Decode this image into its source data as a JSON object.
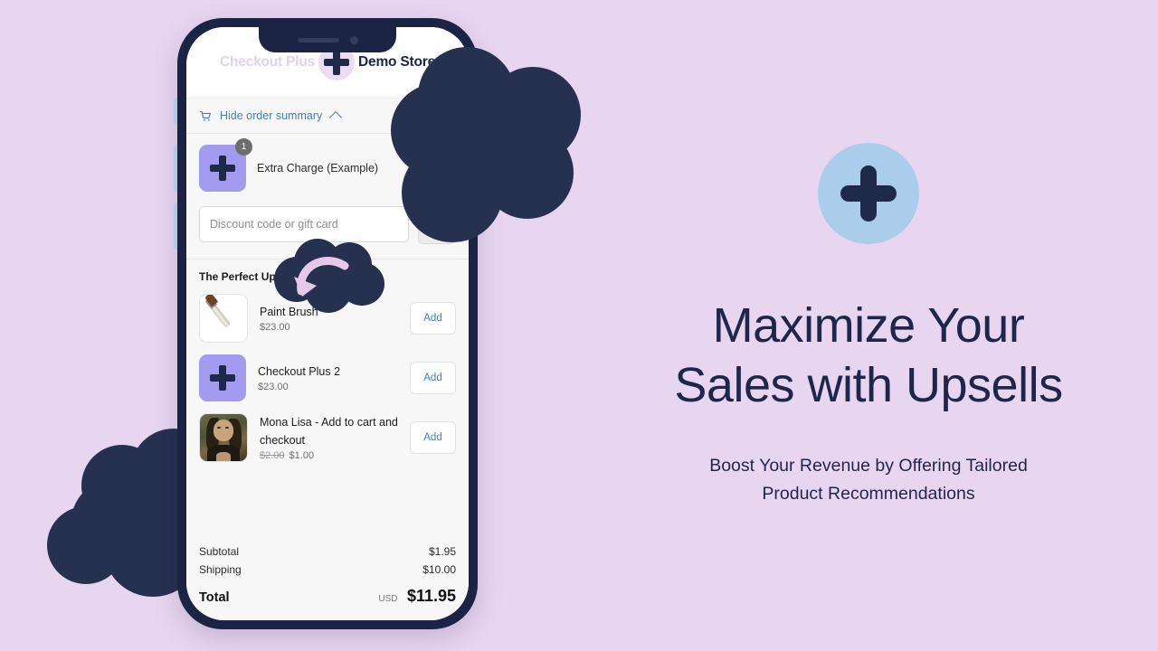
{
  "theme": {
    "background": "#e8d6f1",
    "navy": "#26304f",
    "accent_blue": "#3f7fd0",
    "badge_blue": "#a9cdeb",
    "tile_purple": "#a39bf0"
  },
  "phone": {
    "notch": {
      "speaker": "speaker-bar",
      "camera": "camera-dot"
    },
    "side_buttons": [
      "mute-switch",
      "volume-up",
      "volume-down"
    ]
  },
  "checkout": {
    "header": {
      "ghost_brand": "Checkout Plus",
      "logo_icon": "plus-icon",
      "store_name": "Demo Store"
    },
    "order_summary": {
      "cart_icon": "cart-icon",
      "toggle_label": "Hide order summary",
      "chevron_icon": "chevron-up-icon"
    },
    "cart_items": [
      {
        "thumb": "plus-icon",
        "quantity": "1",
        "title": "Extra Charge (Example)"
      }
    ],
    "discount": {
      "placeholder": "Discount code or gift card",
      "value": "",
      "apply_icon": "arrow-right-icon"
    },
    "upsell": {
      "title": "The Perfect Upsell",
      "items": [
        {
          "thumb": "paint-brush-image",
          "name": "Paint Brush",
          "price": "$23.00",
          "compare_price": "",
          "action": "Add"
        },
        {
          "thumb": "plus-icon",
          "name": "Checkout Plus 2",
          "price": "$23.00",
          "compare_price": "",
          "action": "Add"
        },
        {
          "thumb": "mona-lisa-image",
          "name": "Mona Lisa - Add to cart and checkout",
          "price": "$1.00",
          "compare_price": "$2.00",
          "action": "Add"
        }
      ]
    },
    "totals": {
      "subtotal_label": "Subtotal",
      "subtotal_value": "$1.95",
      "shipping_label": "Shipping",
      "shipping_value": "$10.00",
      "total_label": "Total",
      "currency": "USD",
      "total_value": "$11.95"
    }
  },
  "marketing": {
    "badge_icon": "plus-icon",
    "headline_line1": "Maximize Your",
    "headline_line2": "Sales with Upsells",
    "subhead_line1": "Boost Your Revenue by Offering Tailored",
    "subhead_line2": "Product Recommendations"
  }
}
